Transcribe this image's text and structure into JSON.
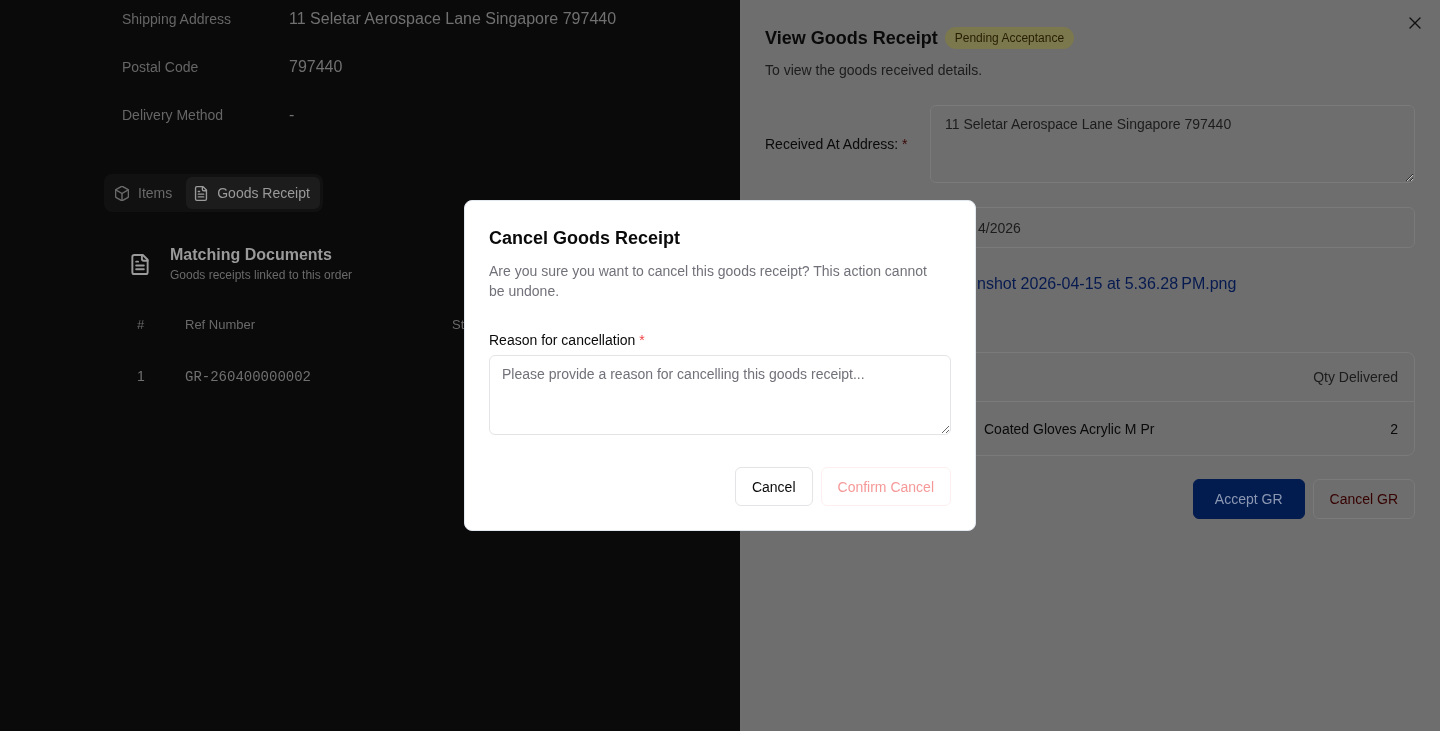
{
  "page": {
    "details": [
      {
        "label": "Shipping Address",
        "value": "11 Seletar Aerospace Lane Singapore 797440"
      },
      {
        "label": "Postal Code",
        "value": "797440"
      },
      {
        "label": "Delivery Method",
        "value": "-"
      }
    ],
    "tabs": [
      {
        "label": "Items",
        "selected": false
      },
      {
        "label": "Goods Receipt",
        "selected": true
      }
    ],
    "matching_documents": {
      "title": "Matching Documents",
      "subtitle": "Goods receipts linked to this order",
      "columns": [
        "#",
        "Ref Number",
        "St"
      ],
      "rows": [
        [
          "1",
          "GR-260400000002"
        ]
      ]
    }
  },
  "drawer": {
    "title": "View Goods Receipt",
    "status_badge": "Pending Acceptance",
    "subtitle": "To view the goods received details.",
    "address": {
      "label": "Received At Address:",
      "required_mark": "*",
      "value": "11 Seletar Aerospace Lane Singapore 797440"
    },
    "date_value": "4/2026",
    "attachment_link": "nshot 2026-04-15 at 5.36.28 PM.png",
    "items_table": {
      "columns": [
        "Qty Delivered"
      ],
      "rows": [
        {
          "item": "Coated Gloves Acrylic M Pr",
          "qty": "2"
        }
      ]
    },
    "buttons": [
      {
        "label": "Accept GR",
        "kind": "primary"
      },
      {
        "label": "Cancel GR",
        "kind": "outline-danger"
      }
    ]
  },
  "dialog": {
    "title": "Cancel Goods Receipt",
    "message": "Are you sure you want to cancel this goods receipt? This action cannot be undone.",
    "reason": {
      "label": "Reason for cancellation",
      "required_mark": "*",
      "placeholder": "Please provide a reason for cancelling this goods receipt..."
    },
    "buttons": [
      {
        "label": "Cancel",
        "kind": "outline",
        "disabled": false
      },
      {
        "label": "Confirm Cancel",
        "kind": "destructive",
        "disabled": true
      }
    ]
  }
}
